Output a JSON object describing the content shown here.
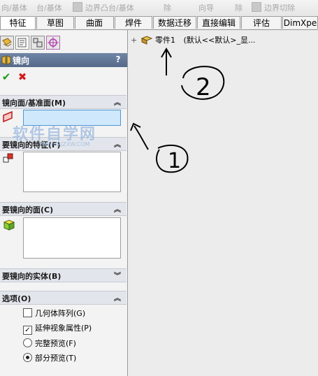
{
  "toolbar": {
    "items": [
      "向/基体",
      "台/基体",
      "边界凸台/基体",
      "除",
      "向导",
      "除",
      "边界切除"
    ]
  },
  "tabs": [
    "特征",
    "草图",
    "曲面",
    "焊件",
    "数据迁移",
    "直接编辑",
    "评估",
    "DimXpe"
  ],
  "active_tab": "特征",
  "panel": {
    "title": "镜向",
    "help": "?",
    "ok": "✔",
    "cancel": "✖",
    "sections": {
      "mirror_plane": {
        "label": "镜向面/基准面(M)"
      },
      "features": {
        "label": "要镜向的特征(F)"
      },
      "faces": {
        "label": "要镜向的面(C)"
      },
      "bodies": {
        "label": "要镜向的实体(B)"
      },
      "options": {
        "label": "选项(O)",
        "geometry_pattern": "几何体阵列(G)",
        "propagate_visual": "延伸视象属性(P)",
        "full_preview": "完整预览(F)",
        "partial_preview": "部分预览(T)"
      }
    },
    "state": {
      "geometry_pattern_checked": false,
      "propagate_visual_checked": true,
      "preview_mode": "partial"
    }
  },
  "tree": {
    "expander": "+",
    "part_name": "零件1",
    "part_suffix": "(默认<<默认>_显..."
  },
  "watermark": {
    "text": "软件自学网",
    "sub": "WWW.RJZXW.COM"
  },
  "annotations": {
    "label_1": "1",
    "label_2": "2"
  }
}
